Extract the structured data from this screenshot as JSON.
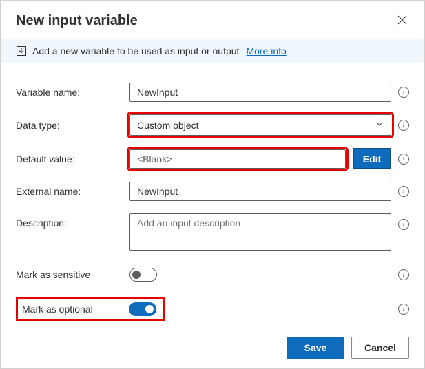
{
  "header": {
    "title": "New input variable"
  },
  "banner": {
    "text": "Add a new variable to be used as input or output",
    "link_text": "More info"
  },
  "form": {
    "variable_name": {
      "label": "Variable name:",
      "value": "NewInput"
    },
    "data_type": {
      "label": "Data type:",
      "value": "Custom object"
    },
    "default_value": {
      "label": "Default value:",
      "value": "<Blank>",
      "edit_label": "Edit"
    },
    "external_name": {
      "label": "External name:",
      "value": "NewInput"
    },
    "description": {
      "label": "Description:",
      "placeholder": "Add an input description"
    },
    "mark_sensitive": {
      "label": "Mark as sensitive"
    },
    "mark_optional": {
      "label": "Mark as optional"
    }
  },
  "footer": {
    "save": "Save",
    "cancel": "Cancel"
  }
}
